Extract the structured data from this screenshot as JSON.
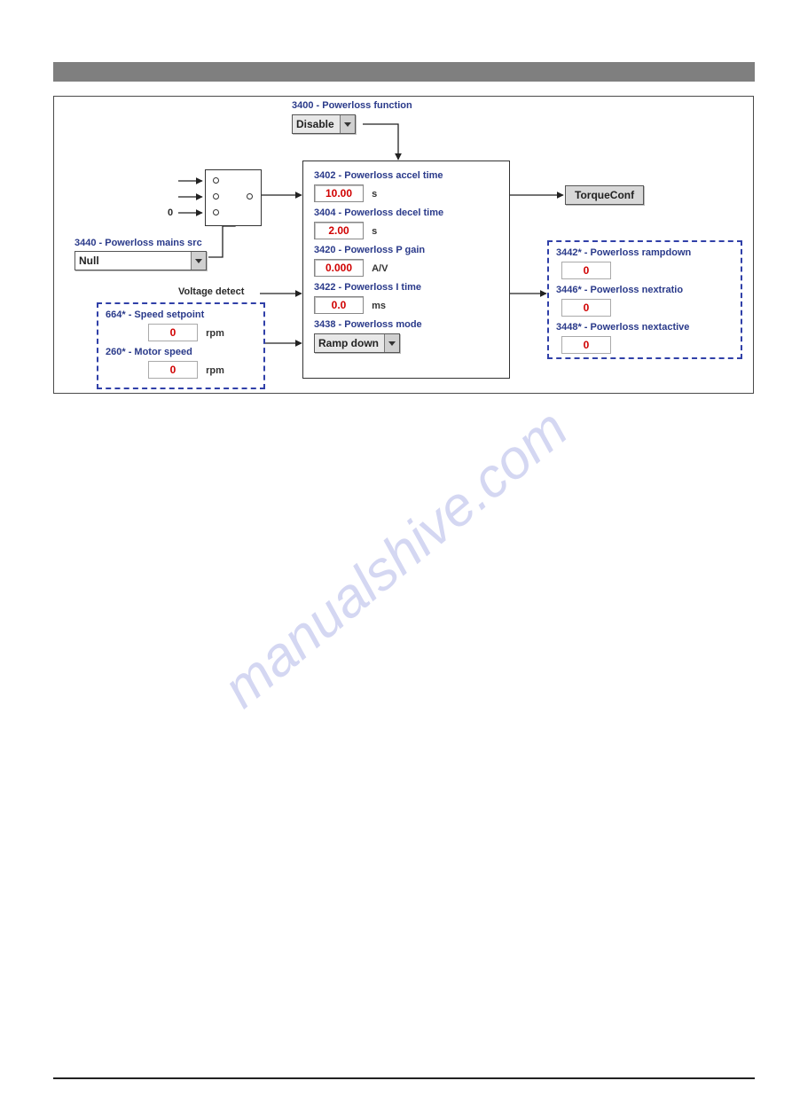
{
  "top": {
    "p3400_label": "3400 - Powerloss function",
    "p3400_value": "Disable"
  },
  "mains": {
    "p3440_label": "3440 - Powerloss mains src",
    "p3440_value": "Null"
  },
  "voltage_detect_label": "Voltage detect",
  "sp_box": {
    "p664_label": "664* - Speed setpoint",
    "p664_value": "0",
    "p664_unit": "rpm",
    "p260_label": "260* - Motor speed",
    "p260_value": "0",
    "p260_unit": "rpm"
  },
  "center": {
    "p3402_label": "3402 - Powerloss accel time",
    "p3402_value": "10.00",
    "p3402_unit": "s",
    "p3404_label": "3404 - Powerloss decel time",
    "p3404_value": "2.00",
    "p3404_unit": "s",
    "p3420_label": "3420 - Powerloss P gain",
    "p3420_value": "0.000",
    "p3420_unit": "A/V",
    "p3422_label": "3422 - Powerloss I time",
    "p3422_value": "0.0",
    "p3422_unit": "ms",
    "p3438_label": "3438 - Powerloss mode",
    "p3438_value": "Ramp down"
  },
  "right_btn": "TorqueConf",
  "outs": {
    "p3442_label": "3442* - Powerloss rampdown",
    "p3442_value": "0",
    "p3446_label": "3446* - Powerloss nextratio",
    "p3446_value": "0",
    "p3448_label": "3448* - Powerloss nextactive",
    "p3448_value": "0"
  },
  "switch_zero": "0",
  "watermark": "manualshive.com"
}
